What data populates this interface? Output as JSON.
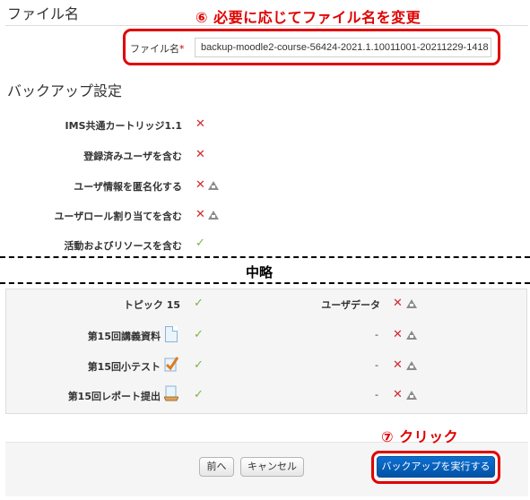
{
  "annotations": {
    "step6": "⑥ 必要に応じてファイル名を変更",
    "step7": "⑦ クリック"
  },
  "file_section": {
    "title": "ファイル名",
    "field_label": "ファイル名",
    "required_mark": "*",
    "value": "backup-moodle2-course-56424-2021.1.10011001-20211229-1418"
  },
  "backup_settings": {
    "title": "バックアップ設定",
    "settings": [
      {
        "label": "IMS共通カートリッジ1.1",
        "state": "off",
        "locked": false
      },
      {
        "label": "登録済みユーザを含む",
        "state": "off",
        "locked": false
      },
      {
        "label": "ユーザ情報を匿名化する",
        "state": "off",
        "locked": true
      },
      {
        "label": "ユーザロール割り当てを含む",
        "state": "off",
        "locked": true
      },
      {
        "label": "活動およびリソースを含む",
        "state": "on",
        "locked": false
      }
    ]
  },
  "omitted_label": "中略",
  "content_panel": {
    "rows": [
      {
        "label": "トピック 15",
        "icon": "none",
        "included": "on",
        "user_label": "ユーザデータ",
        "user_state": "off"
      },
      {
        "label": "第15回講義資料",
        "icon": "file-icon",
        "included": "on",
        "user_label": "-",
        "user_state": "off"
      },
      {
        "label": "第15回小テスト",
        "icon": "quiz-icon",
        "included": "on",
        "user_label": "-",
        "user_state": "off"
      },
      {
        "label": "第15回レポート提出",
        "icon": "assignment-icon",
        "included": "on",
        "user_label": "-",
        "user_state": "off"
      }
    ]
  },
  "buttons": {
    "previous": "前へ",
    "cancel": "キャンセル",
    "execute": "バックアップを実行する"
  },
  "icons": {
    "off": "✕",
    "on": "✓"
  },
  "colors": {
    "annotation": "#e00000",
    "primary_button": "#0152a6",
    "check": "#7cb342",
    "cross": "#d0282c"
  }
}
